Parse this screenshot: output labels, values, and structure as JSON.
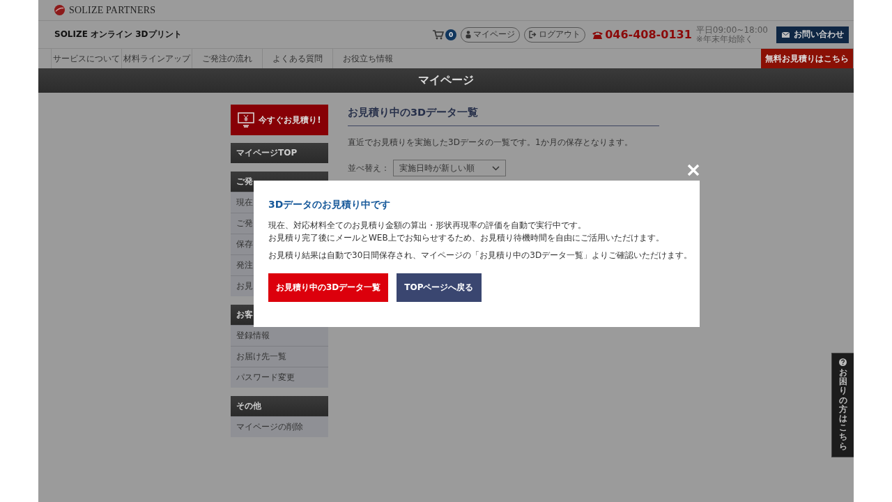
{
  "brand": {
    "logo_text": "SOLIZE PARTNERS",
    "site_title": "SOLIZE オンライン 3Dプリント"
  },
  "header_actions": {
    "cart_count": "0",
    "mypage": "マイページ",
    "logout": "ログアウト",
    "phone": "046-408-0131",
    "hours": "平日09:00~18:00",
    "hours_note": "※年末年始除く",
    "contact": "お問い合わせ"
  },
  "nav": [
    "サービスについて",
    "材料ラインアップ",
    "ご発注の流れ",
    "よくある質問",
    "お役立ち情報"
  ],
  "nav_cta": "無料お見積りはこちら",
  "page_title": "マイページ",
  "sidebar": {
    "quote_button": "今すぐお見積り!",
    "sections": [
      {
        "title": "マイページTOP"
      },
      {
        "title": "ご発",
        "items": [
          "現在",
          "ご発",
          "保存",
          "発注",
          "お見"
        ]
      },
      {
        "title": "お客",
        "items": [
          "登録情報",
          "お届け先一覧",
          "パスワード変更"
        ]
      },
      {
        "title": "その他",
        "items": [
          "マイページの削除"
        ]
      }
    ]
  },
  "main": {
    "title": "お見積り中の3Dデータ一覧",
    "description": "直近でお見積りを実施した3Dデータの一覧です。1か月の保存となります。",
    "sort_label": "並べ替え：",
    "sort_value": "実施日時が新しい順"
  },
  "modal": {
    "title": "3Dデータのお見積り中です",
    "paragraphs": [
      [
        "現在、対応材料全てのお見積り金額の算出・形状再現率の評価を自動で実行中です。",
        "お見積り完了後にメールとWEB上でお知らせするため、お見積り待機時間を自由にご活用いただけます。"
      ],
      [
        "お見積り結果は自動で30日間保存され、マイページの「お見積り中の3Dデータ一覧」よりご確認いただけます。"
      ]
    ],
    "buttons": [
      {
        "label": "お見積り中の3Dデータ一覧",
        "kind": "primary"
      },
      {
        "label": "TOPページへ戻る",
        "kind": "secondary"
      }
    ]
  },
  "help_tab": {
    "text": "お困りの方はこちら"
  }
}
